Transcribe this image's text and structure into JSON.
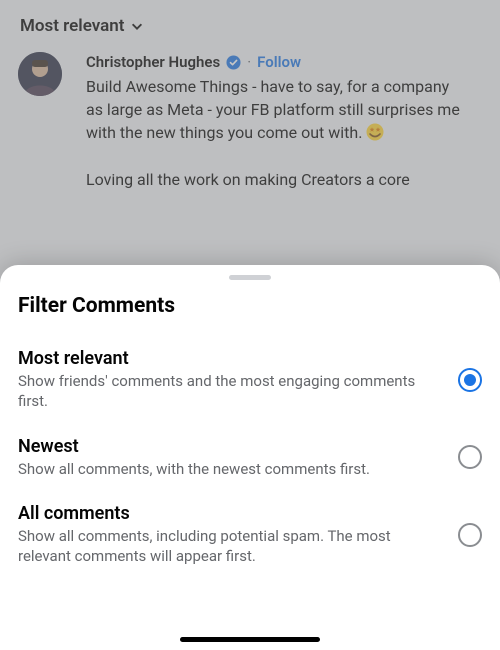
{
  "sort": {
    "current_label": "Most relevant"
  },
  "comment": {
    "author_name": "Christopher Hughes",
    "separator": "·",
    "follow_label": "Follow",
    "body_before_emoji": "Build Awesome Things - have to say, for a company as large as Meta - your FB platform still surprises me with the new things you come out with. ",
    "body_after_emoji": "\n\nLoving all the work on making Creators a core"
  },
  "sheet": {
    "title": "Filter Comments",
    "options": [
      {
        "title": "Most relevant",
        "description": "Show friends' comments and the most engaging comments first.",
        "selected": true
      },
      {
        "title": "Newest",
        "description": "Show all comments, with the newest comments first.",
        "selected": false
      },
      {
        "title": "All comments",
        "description": "Show all comments, including potential spam. The most relevant comments will appear first.",
        "selected": false
      }
    ]
  }
}
